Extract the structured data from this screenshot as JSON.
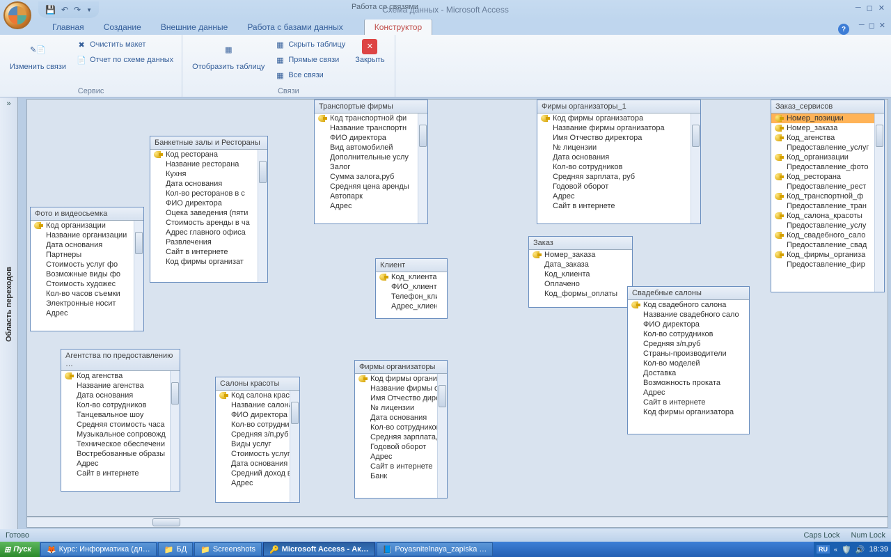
{
  "titlebar": {
    "title": "Схема данных - Microsoft Access",
    "contextual": "Работа со связями"
  },
  "tabs": {
    "home": "Главная",
    "create": "Создание",
    "external": "Внешние данные",
    "dbtools": "Работа с базами данных",
    "design": "Конструктор"
  },
  "ribbon": {
    "g1": {
      "label": "Сервис",
      "edit": "Изменить связи",
      "clear": "Очистить макет",
      "report": "Отчет по схеме данных"
    },
    "g2": {
      "label": "Связи",
      "show": "Отобразить таблицу",
      "hide": "Скрыть таблицу",
      "direct": "Прямые связи",
      "all": "Все связи",
      "close": "Закрыть"
    }
  },
  "nav": {
    "button": "»",
    "label": "Область переходов"
  },
  "tables": {
    "photo": {
      "title": "Фото и видеосьемка",
      "fields": [
        "Код организации",
        "Название организации",
        "Дата основания",
        "Партнеры",
        "Стоимость услуг фо",
        "Возможные виды фо",
        "Стоимость художес",
        "Кол-во часов съемки",
        "Электронные носит",
        "Адрес"
      ]
    },
    "banquet": {
      "title": "Банкетные залы и Рестораны",
      "fields": [
        "Код ресторана",
        "Название ресторана",
        "Кухня",
        "Дата основания",
        "Кол-во ресторанов в с",
        "ФИО директора",
        "Оцека заведения (пяти",
        "Стоимость аренды в ча",
        "Адрес главного офиса",
        "Развлечения",
        "Сайт в интернете",
        "Код фирмы организат"
      ]
    },
    "transport": {
      "title": "Транспортые фирмы",
      "fields": [
        "Код транспортной фи",
        "Название транспортн",
        "ФИО директора",
        "Вид автомобилей",
        "Дополнительные услу",
        "Залог",
        "Сумма залога,руб",
        "Средняя цена аренды",
        "Автопарк",
        "Адрес"
      ]
    },
    "org1": {
      "title": "Фирмы организаторы_1",
      "fields": [
        "Код фирмы организатора",
        "Название фирмы организатора",
        "Имя Отчество директора",
        "№ лицензии",
        "Дата основания",
        "Кол-во сотрудников",
        "Средняя зарплата, руб",
        "Годовой оборот",
        "Адрес",
        "Сайт в интернете"
      ]
    },
    "services": {
      "title": "Заказ_сервисов",
      "fields": [
        "Номер_позиции",
        "Номер_заказа",
        "Код_агенства",
        "Предоставление_услуг",
        "Код_организации",
        "Предоставление_фото",
        "Код_ресторана",
        "Предоставление_рест",
        "Код_транспортной_ф",
        "Предоставление_тран",
        "Код_салона_красоты",
        "Предоставление_услу",
        "Код_свадебного_сало",
        "Предоставление_свад",
        "Код_фирмы_организа",
        "Предоставление_фир"
      ]
    },
    "client": {
      "title": "Клиент",
      "fields": [
        "Код_клиента",
        "ФИО_клиента",
        "Телефон_клиента",
        "Адрес_клиента"
      ]
    },
    "order": {
      "title": "Заказ",
      "fields": [
        "Номер_заказа",
        "Дата_заказа",
        "Код_клиента",
        "Оплачено",
        "Код_формы_оплаты"
      ]
    },
    "wedding": {
      "title": "Свадебные салоны",
      "fields": [
        "Код свадебного салона",
        "Название свадебного салона",
        "ФИО директора",
        "Кол-во сотрудников",
        "Средняя з/п,руб",
        "Страны-производители",
        "Кол-во моделей",
        "Доставка",
        "Возможность проката",
        "Адрес",
        "Сайт в интернете",
        "Код фирмы организатора"
      ]
    },
    "agency": {
      "title": "Агентства по предоставлению …",
      "fields": [
        "Код агенства",
        "Название агенства",
        "Дата основания",
        "Кол-во сотрудников",
        "Танцевальное шоу",
        "Средняя стоимость часа",
        "Музыкальное сопровожд",
        "Техническое обеспечени",
        "Востребованные образы",
        "Адрес",
        "Сайт в интернете"
      ]
    },
    "salon": {
      "title": "Салоны красоты",
      "fields": [
        "Код салона красот",
        "Название салона к",
        "ФИО директора",
        "Кол-во сотрудник",
        "Средняя з/п,руб",
        "Виды услуг",
        "Стоимость услуг,р",
        "Дата основания",
        "Средний доход в м",
        "Адрес"
      ]
    },
    "org": {
      "title": "Фирмы организаторы",
      "fields": [
        "Код фирмы организа",
        "Название фирмы ор",
        "Имя Отчество дирек",
        "№ лицензии",
        "Дата основания",
        "Кол-во сотрудников",
        "Средняя зарплата, ру",
        "Годовой оборот",
        "Адрес",
        "Сайт в интернете",
        "Банк"
      ]
    }
  },
  "status": {
    "ready": "Готово",
    "caps": "Caps Lock",
    "num": "Num Lock"
  },
  "taskbar": {
    "start": "Пуск",
    "t1": "Курс: Информатика (дл…",
    "t2": "БД",
    "t3": "Screenshots",
    "t4": "Microsoft Access - Ак…",
    "t5": "Poyasnitelnaya_zapiska …",
    "lang": "RU",
    "time": "18:39"
  }
}
